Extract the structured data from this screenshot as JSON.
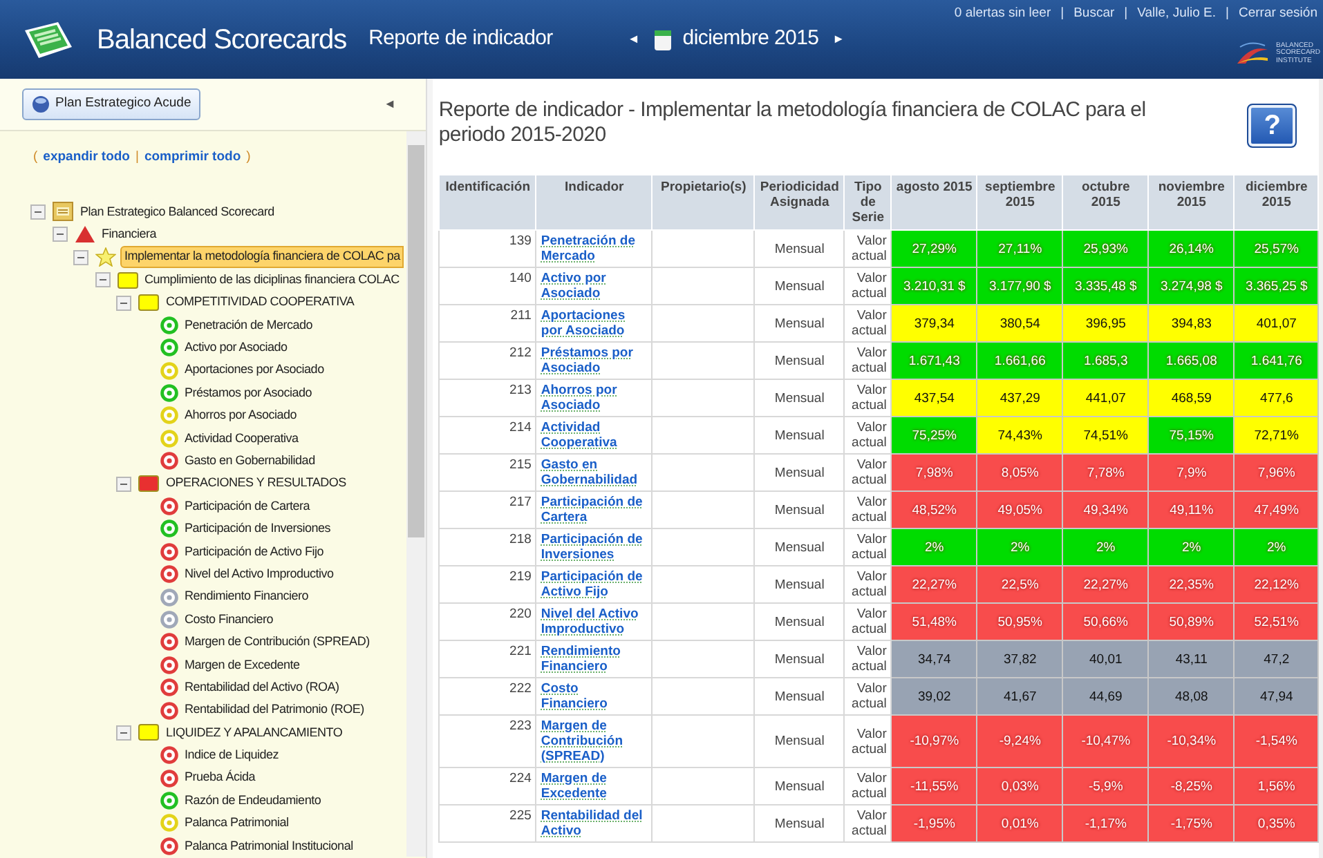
{
  "header": {
    "app_title": "Balanced Scorecards",
    "page_title": "Reporte de indicador",
    "prev": "◄",
    "period": "diciembre 2015",
    "next": "►",
    "links": [
      {
        "kind": "link",
        "text": "0 alertas sin leer"
      },
      {
        "kind": "separator",
        "text": "|"
      },
      {
        "kind": "link",
        "text": "Buscar"
      },
      {
        "kind": "separator",
        "text": "|"
      },
      {
        "kind": "link",
        "text": "Valle, Julio E."
      },
      {
        "kind": "separator",
        "text": "|"
      },
      {
        "kind": "link",
        "text": "Cerrar sesión"
      }
    ],
    "institute_logo": [
      "BALANCED",
      "SCORECARD",
      "INSTITUTE"
    ]
  },
  "sidebar": {
    "plan_button": "Plan Estrategico Acude",
    "collapse": "◄",
    "expand_controls": [
      {
        "kind": "text",
        "text": "("
      },
      {
        "kind": "link",
        "text": "expandir todo"
      },
      {
        "kind": "text",
        "text": "|"
      },
      {
        "kind": "link",
        "text": "comprimir todo"
      },
      {
        "kind": "text",
        "text": ")"
      }
    ],
    "tree": [
      {
        "kind": "plan",
        "label": "Plan Estrategico Balanced Scorecard",
        "expanded": true,
        "selected": false,
        "children": [
          {
            "kind": "perspective",
            "label": "Financiera",
            "expanded": true,
            "selected": false,
            "children": [
              {
                "kind": "objective",
                "label": "Implementar la metodología financiera de COLAC pa",
                "expanded": true,
                "selected": true,
                "children": [
                  {
                    "kind": "folder",
                    "color": "#ffff00",
                    "label": "Cumplimiento de las diciplinas financiera COLAC",
                    "expanded": true,
                    "selected": false,
                    "children": [
                      {
                        "kind": "folder",
                        "color": "#ffff00",
                        "label": "COMPETITIVIDAD COOPERATIVA",
                        "expanded": true,
                        "selected": false,
                        "children": [
                          {
                            "kind": "indicator",
                            "color": "#22c022",
                            "label": "Penetración de Mercado",
                            "selected": false
                          },
                          {
                            "kind": "indicator",
                            "color": "#22c022",
                            "label": "Activo por Asociado",
                            "selected": false
                          },
                          {
                            "kind": "indicator",
                            "color": "#e3d31a",
                            "label": "Aportaciones por Asociado",
                            "selected": false
                          },
                          {
                            "kind": "indicator",
                            "color": "#22c022",
                            "label": "Préstamos por Asociado",
                            "selected": false
                          },
                          {
                            "kind": "indicator",
                            "color": "#e3d31a",
                            "label": "Ahorros por Asociado",
                            "selected": false
                          },
                          {
                            "kind": "indicator",
                            "color": "#e3d31a",
                            "label": "Actividad Cooperativa",
                            "selected": false
                          },
                          {
                            "kind": "indicator",
                            "color": "#e03c3c",
                            "label": "Gasto en Gobernabilidad",
                            "selected": false
                          }
                        ]
                      },
                      {
                        "kind": "folder",
                        "color": "#e83030",
                        "label": "OPERACIONES Y RESULTADOS",
                        "expanded": true,
                        "selected": false,
                        "children": [
                          {
                            "kind": "indicator",
                            "color": "#e03c3c",
                            "label": "Participación de Cartera",
                            "selected": false
                          },
                          {
                            "kind": "indicator",
                            "color": "#22c022",
                            "label": "Participación de Inversiones",
                            "selected": false
                          },
                          {
                            "kind": "indicator",
                            "color": "#e03c3c",
                            "label": "Participación de Activo Fijo",
                            "selected": false
                          },
                          {
                            "kind": "indicator",
                            "color": "#e03c3c",
                            "label": "Nivel del Activo Improductivo",
                            "selected": false
                          },
                          {
                            "kind": "indicator",
                            "color": "#a0a8b8",
                            "label": "Rendimiento Financiero",
                            "selected": false
                          },
                          {
                            "kind": "indicator",
                            "color": "#a0a8b8",
                            "label": "Costo Financiero",
                            "selected": false
                          },
                          {
                            "kind": "indicator",
                            "color": "#e03c3c",
                            "label": "Margen de Contribución (SPREAD)",
                            "selected": false
                          },
                          {
                            "kind": "indicator",
                            "color": "#e03c3c",
                            "label": "Margen de Excedente",
                            "selected": false
                          },
                          {
                            "kind": "indicator",
                            "color": "#e03c3c",
                            "label": "Rentabilidad del Activo (ROA)",
                            "selected": false
                          },
                          {
                            "kind": "indicator",
                            "color": "#e03c3c",
                            "label": "Rentabilidad del Patrimonio (ROE)",
                            "selected": false
                          }
                        ]
                      },
                      {
                        "kind": "folder",
                        "color": "#ffff00",
                        "label": "LIQUIDEZ Y APALANCAMIENTO",
                        "expanded": true,
                        "selected": false,
                        "children": [
                          {
                            "kind": "indicator",
                            "color": "#e03c3c",
                            "label": "Indice de Liquidez",
                            "selected": false
                          },
                          {
                            "kind": "indicator",
                            "color": "#e03c3c",
                            "label": "Prueba Ácida",
                            "selected": false
                          },
                          {
                            "kind": "indicator",
                            "color": "#22c022",
                            "label": "Razón de Endeudamiento",
                            "selected": false
                          },
                          {
                            "kind": "indicator",
                            "color": "#e3d31a",
                            "label": "Palanca Patrimonial",
                            "selected": false
                          },
                          {
                            "kind": "indicator",
                            "color": "#e03c3c",
                            "label": "Palanca Patrimonial Institucional",
                            "selected": false
                          }
                        ]
                      }
                    ]
                  }
                ]
              }
            ]
          }
        ]
      }
    ]
  },
  "report": {
    "title": "Reporte de indicador - Implementar  la metodología financiera de COLAC para el periodo 2015-2020",
    "help": "?",
    "table": {
      "columns": [
        "Identificación",
        "Indicador",
        "Propietario(s)",
        "Periodicidad Asignada",
        "Tipo de Serie",
        "agosto 2015",
        "septiembre 2015",
        "octubre 2015",
        "noviembre 2015",
        "diciembre 2015"
      ],
      "rows": [
        {
          "id": "139",
          "indicator": "Penetración de Mercado",
          "periodicity": "Mensual",
          "series": "Valor actual",
          "values": [
            {
              "text": "27,29%",
              "color": "#00dc00"
            },
            {
              "text": "27,11%",
              "color": "#00dc00"
            },
            {
              "text": "25,93%",
              "color": "#00dc00"
            },
            {
              "text": "26,14%",
              "color": "#00dc00"
            },
            {
              "text": "25,57%",
              "color": "#00dc00"
            }
          ]
        },
        {
          "id": "140",
          "indicator": "Activo por Asociado",
          "periodicity": "Mensual",
          "series": "Valor actual",
          "values": [
            {
              "text": "3.210,31 $",
              "color": "#00dc00"
            },
            {
              "text": "3.177,90 $",
              "color": "#00dc00"
            },
            {
              "text": "3.335,48 $",
              "color": "#00dc00"
            },
            {
              "text": "3.274,98 $",
              "color": "#00dc00"
            },
            {
              "text": "3.365,25 $",
              "color": "#00dc00"
            }
          ]
        },
        {
          "id": "211",
          "indicator": "Aportaciones por Asociado",
          "periodicity": "Mensual",
          "series": "Valor actual",
          "values": [
            {
              "text": "379,34",
              "color": "#ffff00"
            },
            {
              "text": "380,54",
              "color": "#ffff00"
            },
            {
              "text": "396,95",
              "color": "#ffff00"
            },
            {
              "text": "394,83",
              "color": "#ffff00"
            },
            {
              "text": "401,07",
              "color": "#ffff00"
            }
          ]
        },
        {
          "id": "212",
          "indicator": "Préstamos por Asociado",
          "periodicity": "Mensual",
          "series": "Valor actual",
          "values": [
            {
              "text": "1.671,43",
              "color": "#00dc00"
            },
            {
              "text": "1.661,66",
              "color": "#00dc00"
            },
            {
              "text": "1.685,3",
              "color": "#00dc00"
            },
            {
              "text": "1.665,08",
              "color": "#00dc00"
            },
            {
              "text": "1.641,76",
              "color": "#00dc00"
            }
          ]
        },
        {
          "id": "213",
          "indicator": "Ahorros por Asociado",
          "periodicity": "Mensual",
          "series": "Valor actual",
          "values": [
            {
              "text": "437,54",
              "color": "#ffff00"
            },
            {
              "text": "437,29",
              "color": "#ffff00"
            },
            {
              "text": "441,07",
              "color": "#ffff00"
            },
            {
              "text": "468,59",
              "color": "#ffff00"
            },
            {
              "text": "477,6",
              "color": "#ffff00"
            }
          ]
        },
        {
          "id": "214",
          "indicator": "Actividad Cooperativa",
          "periodicity": "Mensual",
          "series": "Valor actual",
          "values": [
            {
              "text": "75,25%",
              "color": "#00dc00"
            },
            {
              "text": "74,43%",
              "color": "#ffff00"
            },
            {
              "text": "74,51%",
              "color": "#ffff00"
            },
            {
              "text": "75,15%",
              "color": "#00dc00"
            },
            {
              "text": "72,71%",
              "color": "#ffff00"
            }
          ]
        },
        {
          "id": "215",
          "indicator": "Gasto en Gobernabilidad",
          "periodicity": "Mensual",
          "series": "Valor actual",
          "values": [
            {
              "text": "7,98%",
              "color": "#f84c4c"
            },
            {
              "text": "8,05%",
              "color": "#f84c4c"
            },
            {
              "text": "7,78%",
              "color": "#f84c4c"
            },
            {
              "text": "7,9%",
              "color": "#f84c4c"
            },
            {
              "text": "7,96%",
              "color": "#f84c4c"
            }
          ]
        },
        {
          "id": "217",
          "indicator": "Participación de Cartera",
          "periodicity": "Mensual",
          "series": "Valor actual",
          "values": [
            {
              "text": "48,52%",
              "color": "#f84c4c"
            },
            {
              "text": "49,05%",
              "color": "#f84c4c"
            },
            {
              "text": "49,34%",
              "color": "#f84c4c"
            },
            {
              "text": "49,11%",
              "color": "#f84c4c"
            },
            {
              "text": "47,49%",
              "color": "#f84c4c"
            }
          ]
        },
        {
          "id": "218",
          "indicator": "Participación de Inversiones",
          "periodicity": "Mensual",
          "series": "Valor actual",
          "values": [
            {
              "text": "2%",
              "color": "#00dc00"
            },
            {
              "text": "2%",
              "color": "#00dc00"
            },
            {
              "text": "2%",
              "color": "#00dc00"
            },
            {
              "text": "2%",
              "color": "#00dc00"
            },
            {
              "text": "2%",
              "color": "#00dc00"
            }
          ]
        },
        {
          "id": "219",
          "indicator": "Participación de Activo Fijo",
          "periodicity": "Mensual",
          "series": "Valor actual",
          "values": [
            {
              "text": "22,27%",
              "color": "#f84c4c"
            },
            {
              "text": "22,5%",
              "color": "#f84c4c"
            },
            {
              "text": "22,27%",
              "color": "#f84c4c"
            },
            {
              "text": "22,35%",
              "color": "#f84c4c"
            },
            {
              "text": "22,12%",
              "color": "#f84c4c"
            }
          ]
        },
        {
          "id": "220",
          "indicator": "Nivel del Activo Improductivo",
          "periodicity": "Mensual",
          "series": "Valor actual",
          "values": [
            {
              "text": "51,48%",
              "color": "#f84c4c"
            },
            {
              "text": "50,95%",
              "color": "#f84c4c"
            },
            {
              "text": "50,66%",
              "color": "#f84c4c"
            },
            {
              "text": "50,89%",
              "color": "#f84c4c"
            },
            {
              "text": "52,51%",
              "color": "#f84c4c"
            }
          ]
        },
        {
          "id": "221",
          "indicator": "Rendimiento Financiero",
          "periodicity": "Mensual",
          "series": "Valor actual",
          "values": [
            {
              "text": "34,74",
              "color": "#98a3b3"
            },
            {
              "text": "37,82",
              "color": "#98a3b3"
            },
            {
              "text": "40,01",
              "color": "#98a3b3"
            },
            {
              "text": "43,11",
              "color": "#98a3b3"
            },
            {
              "text": "47,2",
              "color": "#98a3b3"
            }
          ]
        },
        {
          "id": "222",
          "indicator": "Costo Financiero",
          "periodicity": "Mensual",
          "series": "Valor actual",
          "values": [
            {
              "text": "39,02",
              "color": "#98a3b3"
            },
            {
              "text": "41,67",
              "color": "#98a3b3"
            },
            {
              "text": "44,69",
              "color": "#98a3b3"
            },
            {
              "text": "48,08",
              "color": "#98a3b3"
            },
            {
              "text": "47,94",
              "color": "#98a3b3"
            }
          ]
        },
        {
          "id": "223",
          "indicator": "Margen de Contribución (SPREAD)",
          "periodicity": "Mensual",
          "series": "Valor actual",
          "values": [
            {
              "text": "-10,97%",
              "color": "#f84c4c"
            },
            {
              "text": "-9,24%",
              "color": "#f84c4c"
            },
            {
              "text": "-10,47%",
              "color": "#f84c4c"
            },
            {
              "text": "-10,34%",
              "color": "#f84c4c"
            },
            {
              "text": "-1,54%",
              "color": "#f84c4c"
            }
          ]
        },
        {
          "id": "224",
          "indicator": "Margen de Excedente",
          "periodicity": "Mensual",
          "series": "Valor actual",
          "values": [
            {
              "text": "-11,55%",
              "color": "#f84c4c"
            },
            {
              "text": "0,03%",
              "color": "#f84c4c"
            },
            {
              "text": "-5,9%",
              "color": "#f84c4c"
            },
            {
              "text": "-8,25%",
              "color": "#f84c4c"
            },
            {
              "text": "1,56%",
              "color": "#f84c4c"
            }
          ]
        },
        {
          "id": "225",
          "indicator": "Rentabilidad del Activo",
          "periodicity": "Mensual",
          "series": "Valor actual",
          "values": [
            {
              "text": "-1,95%",
              "color": "#f84c4c"
            },
            {
              "text": "0,01%",
              "color": "#f84c4c"
            },
            {
              "text": "-1,17%",
              "color": "#f84c4c"
            },
            {
              "text": "-1,75%",
              "color": "#f84c4c"
            },
            {
              "text": "0,35%",
              "color": "#f84c4c"
            }
          ]
        }
      ]
    }
  }
}
